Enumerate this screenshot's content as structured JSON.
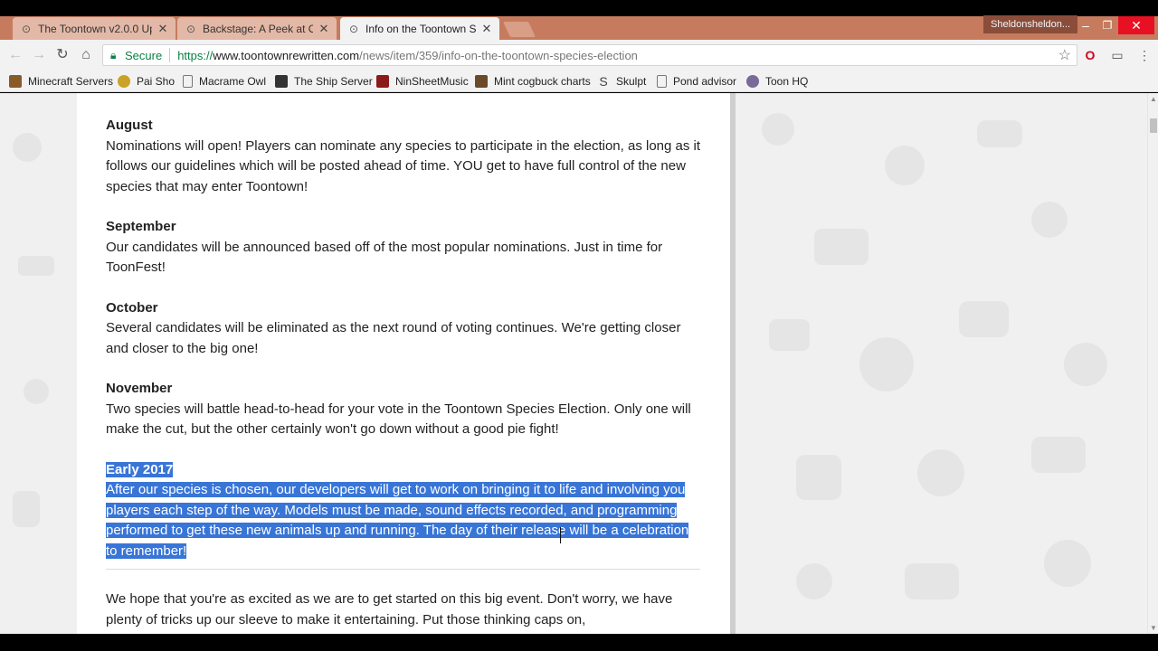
{
  "tabs": [
    {
      "title": "The Toontown v2.0.0 Up",
      "icon": "ttr-icon"
    },
    {
      "title": "Backstage: A Peek at Ou",
      "icon": "ttr-icon"
    },
    {
      "title": "Info on the Toontown Sp",
      "icon": "ttr-icon",
      "active": true
    }
  ],
  "profile_name": "Sheldonsheldon...",
  "address": {
    "secure_label": "Secure",
    "url_scheme": "https://",
    "url_host": "www.toontownrewritten.com",
    "url_path": "/news/item/359/info-on-the-toontown-species-election"
  },
  "bookmarks": [
    {
      "label": "Minecraft Servers",
      "icon_color": "#8b5a2b"
    },
    {
      "label": "Pai Sho",
      "icon_color": "#c9a227"
    },
    {
      "label": "Macrame Owl",
      "icon_color": "#ffffff"
    },
    {
      "label": "The Ship Server",
      "icon_color": "#333333"
    },
    {
      "label": "NinSheetMusic",
      "icon_color": "#8b1a1a"
    },
    {
      "label": "Mint cogbuck charts",
      "icon_color": "#6b4a2a"
    },
    {
      "label": "Skulpt",
      "icon_color": "#444444"
    },
    {
      "label": "Pond advisor",
      "icon_color": "#ffffff"
    },
    {
      "label": "Toon HQ",
      "icon_color": "#7a6a9a"
    }
  ],
  "article": {
    "sections": [
      {
        "month": "August",
        "text": "Nominations will open! Players can nominate any species to participate in the election, as long as it follows our guidelines which will be posted ahead of time. YOU get to have full control of the new species that may enter Toontown!"
      },
      {
        "month": "September",
        "text": "Our candidates will be announced based off of the most popular nominations. Just in time for ToonFest!"
      },
      {
        "month": "October",
        "text": "Several candidates will be eliminated as the next round of voting continues. We're getting closer and closer to the big one!"
      },
      {
        "month": "November",
        "text": "Two species will battle head-to-head for your vote in the Toontown Species Election. Only one will make the cut, but the other certainly won't go down without a good pie fight!"
      },
      {
        "month": "Early 2017",
        "text": "After our species is chosen, our developers will get to work on bringing it to life and involving you players each step of the way. Models must be made, sound effects recorded, and programming performed to get these new animals up and running. The day of their release will be a celebration to remember!"
      }
    ],
    "closing": "We hope that you're as excited as we are to get started on this big event. Don't worry, we have plenty of tricks up our sleeve to make it entertaining. Put those thinking caps on,"
  }
}
